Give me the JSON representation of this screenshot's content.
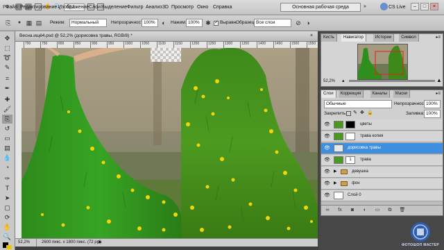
{
  "menubar": {
    "logo": "PS",
    "zoom": "52,2",
    "items": [
      "Файл",
      "Редактирование",
      "Изображение",
      "Слои",
      "Выделение",
      "Фильтр",
      "Анализ",
      "3D",
      "Просмотр",
      "Окно",
      "Справка"
    ],
    "workspace": "Основная рабочая среда",
    "cs_live": "CS Live",
    "win_min": "–",
    "win_max": "□",
    "win_close": "×"
  },
  "options": {
    "mode_label": "Режим:",
    "mode_value": "Нормальный",
    "opacity_label": "Непрозрачность:",
    "opacity_value": "100%",
    "pressure_label": "Нажим:",
    "pressure_value": "100%",
    "align_label": "Выравн.",
    "sample_label": "Образец:",
    "sample_value": "Все слои"
  },
  "document": {
    "title": "Весна.ищё4.psd @ 52,2% (дорисовка травы, RGB/8) *",
    "close": "×",
    "ruler_ticks": [
      "700",
      "750",
      "800",
      "850",
      "900",
      "950",
      "1000",
      "1050",
      "1100",
      "1150",
      "1200",
      "1250",
      "1300",
      "1350",
      "1400",
      "1450",
      "1500",
      "1550"
    ],
    "status_zoom": "52,2%",
    "status_info": "2600 пикс. x 1800 пикс. (72 ppi)"
  },
  "navigator": {
    "tabs": [
      "Кисть",
      "Навигатор",
      "Истории",
      "Символ"
    ],
    "zoom": "52,2%"
  },
  "layers": {
    "tabs": [
      "Слои",
      "Коррекция",
      "Каналы",
      "Маски"
    ],
    "blend_mode": "Обычные",
    "opacity_label": "Непрозрачность:",
    "opacity_value": "100%",
    "lock_label": "Закрепить:",
    "fill_label": "Заливка:",
    "fill_value": "100%",
    "rows": [
      {
        "name": "цветы",
        "selected": false
      },
      {
        "name": "трава копия",
        "selected": false
      },
      {
        "name": "дорисовка травы",
        "selected": true
      },
      {
        "name": "трава",
        "selected": false
      },
      {
        "name": "девушка",
        "selected": false
      },
      {
        "name": "фон",
        "selected": false
      },
      {
        "name": "Слой 0",
        "selected": false
      }
    ],
    "mask_number": "1"
  },
  "watermark": {
    "text": "ФОТОШОП МАСТЕР"
  },
  "colors": {
    "selection": "#3f8fe0",
    "grass": "#3a8a1a",
    "flower": "#f2d40a"
  }
}
